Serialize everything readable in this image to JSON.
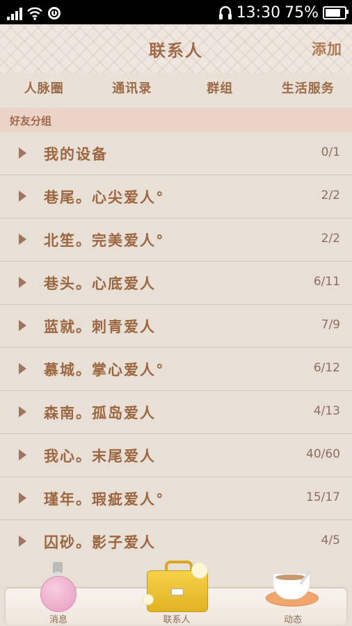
{
  "status_bar": {
    "time": "13:30",
    "battery": "75%"
  },
  "header": {
    "title": "联系人",
    "add_label": "添加"
  },
  "tabs": [
    "人脉圈",
    "通讯录",
    "群组",
    "生活服务"
  ],
  "section": {
    "title": "好友分组"
  },
  "groups": [
    {
      "name": "我的设备",
      "count": "0/1"
    },
    {
      "name": "巷尾。心尖爱人°",
      "count": "2/2"
    },
    {
      "name": "北笙。完美爱人°",
      "count": "2/2"
    },
    {
      "name": "巷头。心底爱人",
      "count": "6/11"
    },
    {
      "name": "蓝就。刺青爱人",
      "count": "7/9"
    },
    {
      "name": "慕城。掌心爱人°",
      "count": "6/12"
    },
    {
      "name": "森南。孤岛爱人",
      "count": "4/13"
    },
    {
      "name": "我心。末尾爱人",
      "count": "40/60"
    },
    {
      "name": "瑾年。瑕疵爱人°",
      "count": "15/17"
    },
    {
      "name": "囚砂。影子爱人",
      "count": "4/5"
    }
  ],
  "dock": {
    "messages_label": "消息",
    "contacts_label": "联系人",
    "feed_label": "动态"
  },
  "colors": {
    "accent": "#a06a48",
    "background": "#e8e0d6",
    "section": "#ecd3c8"
  }
}
